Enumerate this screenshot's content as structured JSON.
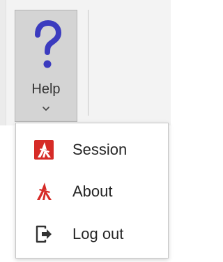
{
  "ribbon": {
    "help_button": {
      "label": "Help",
      "icon": "question-mark-icon",
      "dropdown_icon": "chevron-down-icon",
      "state": "pressed"
    }
  },
  "menu": {
    "items": [
      {
        "label": "Session",
        "icon": "session-logo-icon"
      },
      {
        "label": "About",
        "icon": "about-logo-icon"
      },
      {
        "label": "Log out",
        "icon": "logout-icon"
      }
    ]
  },
  "colors": {
    "accent_blue": "#3b3bbf",
    "brand_red": "#d62b27",
    "menu_text": "#262626",
    "pressed_button": "#d4d4d4"
  }
}
